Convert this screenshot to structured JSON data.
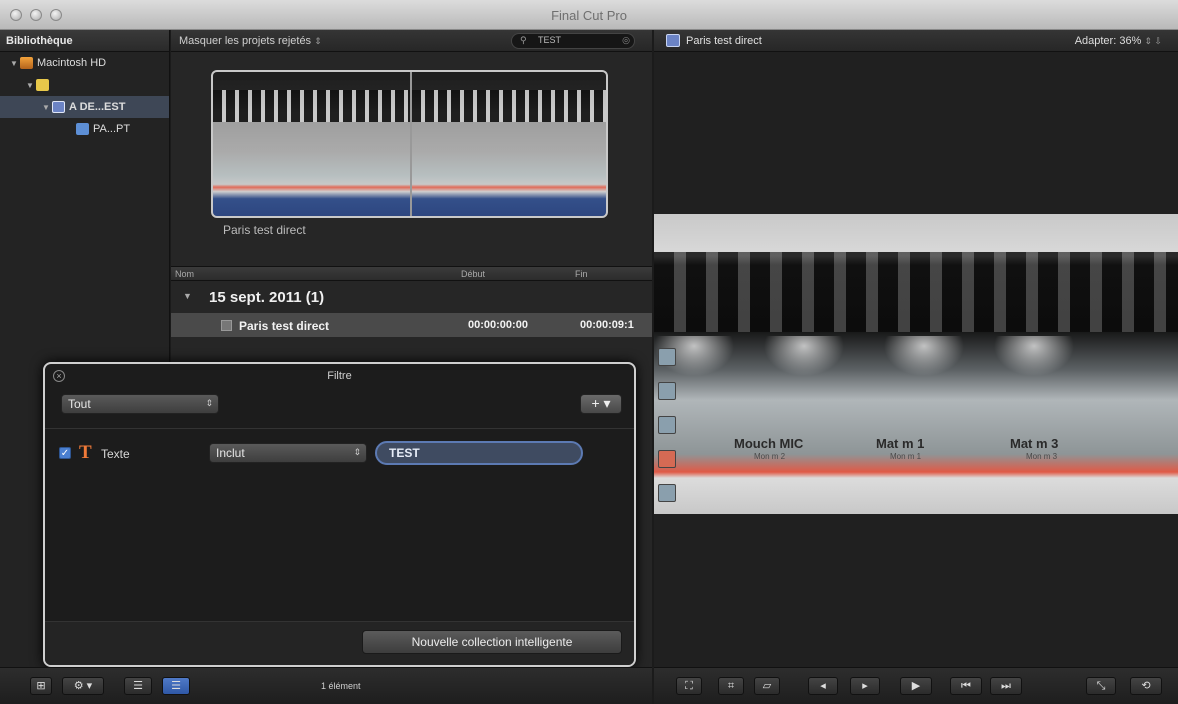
{
  "window": {
    "title": "Final Cut Pro"
  },
  "library": {
    "header": "Bibliothèque",
    "items": [
      {
        "label": "Macintosh HD"
      },
      {
        "label": ""
      },
      {
        "label": "A DE...EST"
      },
      {
        "label": "PA...PT"
      }
    ]
  },
  "browser": {
    "filter_popup": "Masquer les projets rejetés",
    "search_value": "TEST",
    "clip_thumbnail_name": "Paris test direct",
    "columns": {
      "name": "Nom",
      "start": "Début",
      "end": "Fin"
    },
    "date_group": "15 sept. 2011  (1)",
    "clip_row": {
      "name": "Paris test direct",
      "start": "00:00:00:00",
      "end": "00:00:09:1"
    }
  },
  "viewer": {
    "title": "Paris test direct",
    "zoom": "Adapter:  36%",
    "image_labels": [
      {
        "text": "Mouch MIC",
        "sub": "Mon m 2"
      },
      {
        "text": "Mat m  1",
        "sub": "Mon m 1"
      },
      {
        "text": "Mat m  3",
        "sub": "Mon m 3"
      }
    ]
  },
  "filter_hud": {
    "title": "Filtre",
    "match_popup": "Tout",
    "rule": {
      "type_label": "Texte",
      "operator": "Inclut",
      "value": "TEST"
    },
    "new_collection_button": "Nouvelle collection intelligente"
  },
  "status": {
    "item_count": "1 élément"
  },
  "colors": {
    "accent_blue": "#4a7fd0",
    "selection": "#3e4756",
    "text_icon": "#f07a39"
  }
}
